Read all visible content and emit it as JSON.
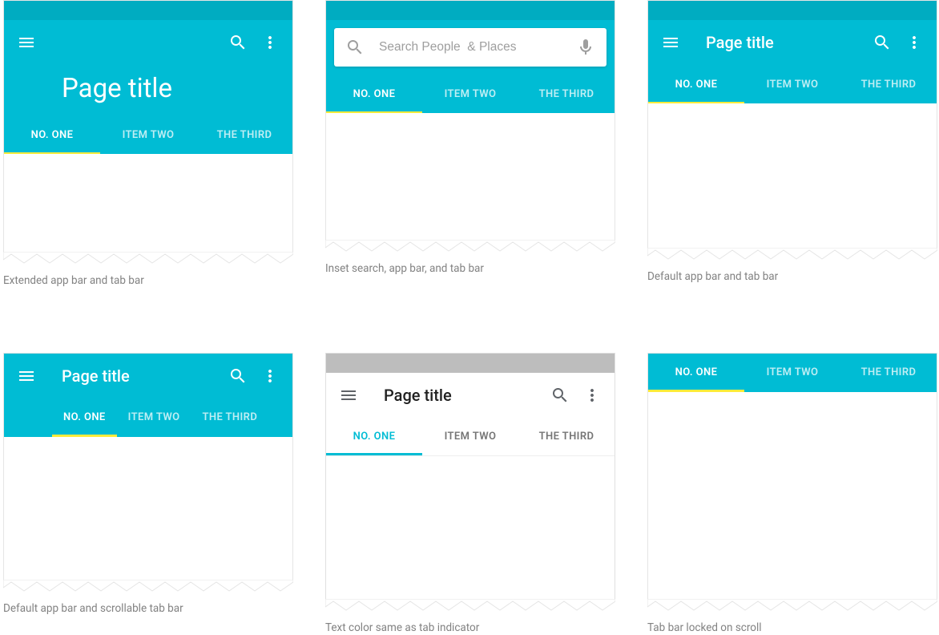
{
  "common": {
    "page_title": "Page title",
    "tabs": [
      "NO. ONE",
      "ITEM TWO",
      "THE THIRD"
    ],
    "search_placeholder": "Search People  & Places"
  },
  "examples": [
    {
      "id": "ex1",
      "caption": "Extended app bar and tab bar"
    },
    {
      "id": "ex2",
      "caption": "Inset search, app bar, and tab bar"
    },
    {
      "id": "ex3",
      "caption": "Default app bar and tab bar"
    },
    {
      "id": "ex4",
      "caption": "Default app bar and scrollable tab bar"
    },
    {
      "id": "ex5",
      "caption": "Text color same as tab indicator"
    },
    {
      "id": "ex6",
      "caption": "Tab bar locked on scroll"
    }
  ],
  "colors": {
    "primary": "#00bcd4",
    "primary_dark": "#00acc1",
    "indicator": "#ffeb3b"
  }
}
